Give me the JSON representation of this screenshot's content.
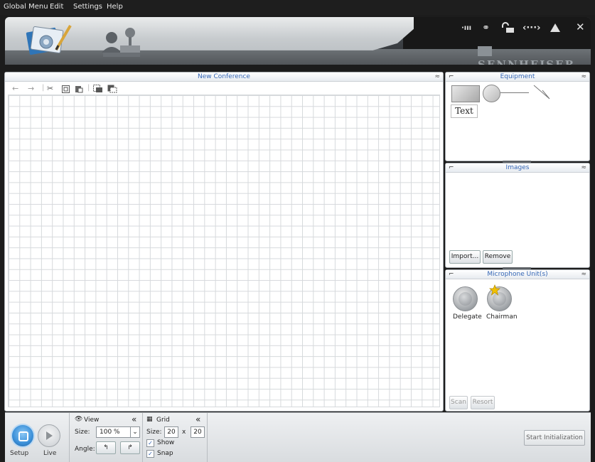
{
  "menu": [
    "Global Menu",
    "Edit",
    "Settings",
    "Help"
  ],
  "header": {
    "brand": "SENNHEISER",
    "icons": [
      "signal-icon",
      "network-icon",
      "lock-icon",
      "connection-icon",
      "eject-icon",
      "close-icon"
    ]
  },
  "canvas": {
    "title": "New Conference",
    "toolbar": [
      "undo-icon",
      "redo-icon",
      "cut-icon",
      "copy-icon",
      "paste-icon",
      "bring-to-front-icon",
      "send-to-back-icon"
    ]
  },
  "equipment": {
    "title": "Equipment",
    "text_item": "Text"
  },
  "images": {
    "title": "Images",
    "import_label": "Import...",
    "remove_label": "Remove"
  },
  "microphones": {
    "title": "Microphone Unit(s)",
    "units": [
      "Delegate",
      "Chairman"
    ],
    "scan_label": "Scan",
    "resort_label": "Resort"
  },
  "modes": {
    "setup_label": "Setup",
    "live_label": "Live"
  },
  "view": {
    "title": "View",
    "size_label": "Size:",
    "size_value": "100 %",
    "angle_label": "Angle:"
  },
  "grid": {
    "title": "Grid",
    "size_label": "Size:",
    "width": "20",
    "times": "x",
    "height": "20",
    "show_label": "Show",
    "snap_label": "Snap",
    "show_checked": true,
    "snap_checked": true
  },
  "actions": {
    "start_label": "Start Initialization"
  },
  "colors": {
    "title_blue": "#3466b5",
    "setup_active": "#3a8fd8"
  }
}
